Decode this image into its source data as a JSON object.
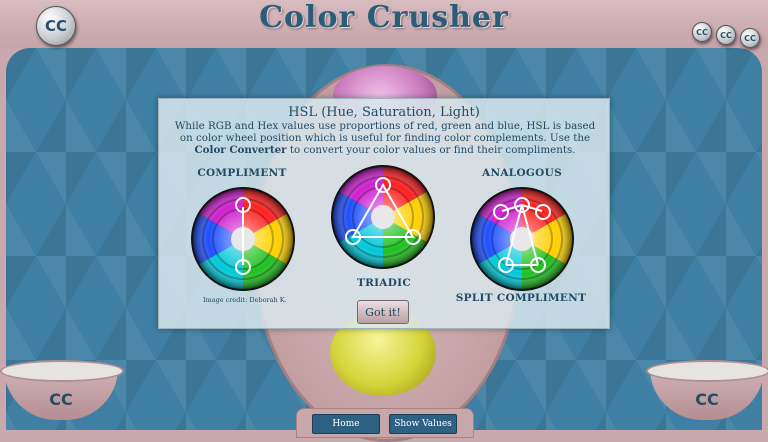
{
  "app": {
    "title": "Color Crusher",
    "logo_text": "CC"
  },
  "header": {
    "small_coins": [
      "CC",
      "CC",
      "CC"
    ]
  },
  "bowls": {
    "left_label": "CC",
    "right_label": "CC"
  },
  "nav": {
    "home_label": "Home",
    "show_values_label": "Show Values"
  },
  "modal": {
    "title": "HSL (Hue, Saturation, Light)",
    "body_before": "While RGB and Hex values use proportions of red, green and blue, HSL is based on color wheel position which is useful for finding color complements. Use the",
    "link_text": "Color Converter",
    "body_after": "to convert your color values or find their compliments.",
    "labels": {
      "compliment": "COMPLIMENT",
      "triadic": "TRIADIC",
      "analogous": "ANALOGOUS",
      "split_compliment": "SPLIT COMPLIMENT"
    },
    "credit": "Image credit: Deborah K.",
    "button_label": "Got it!"
  },
  "colors": {
    "accent": "#2b5d7a",
    "frame": "#c9a9ad",
    "playfield": "#3f7fa3",
    "button": "#2d6183"
  },
  "icons": {
    "wheels": [
      "color-wheel-compliment-icon",
      "color-wheel-triadic-icon",
      "color-wheel-analogous-icon"
    ]
  }
}
